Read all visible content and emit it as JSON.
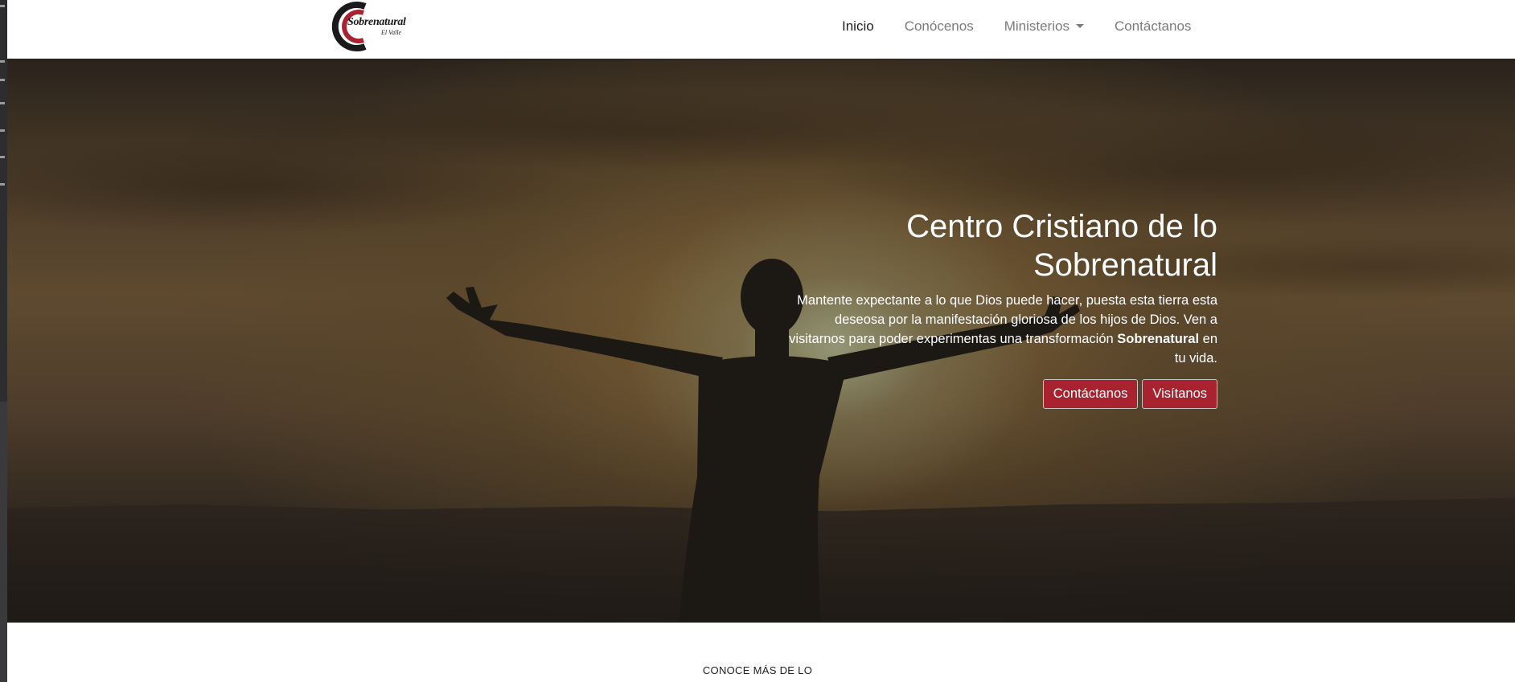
{
  "brand": {
    "logo_text": "Sobrenatural",
    "logo_subtext": "El Valle",
    "colors": {
      "logo_red": "#a8232f",
      "logo_dark": "#1a1a1a"
    }
  },
  "nav": {
    "items": [
      {
        "label": "Inicio",
        "active": true
      },
      {
        "label": "Conócenos",
        "active": false
      },
      {
        "label": "Ministerios",
        "active": false,
        "dropdown": true
      },
      {
        "label": "Contáctanos",
        "active": false
      }
    ],
    "dropdown_icon": "caret-down-icon"
  },
  "hero": {
    "title_line1": "Centro Cristiano de lo",
    "title_line2": "Sobrenatural",
    "text_before_bold": "Mantente expectante a lo que Dios puede hacer, puesta esta tierra esta deseosa por la manifestación gloriosa de los hijos de Dios. Ven a visitarnos para poder experimentas una transformación ",
    "text_bold": "Sobrenatural",
    "text_after_bold": " en tu vida.",
    "buttons": {
      "contact_label": "Contáctanos",
      "visit_label": "Visítanos"
    },
    "colors": {
      "button_bg": "#a8232f"
    }
  },
  "next_section": {
    "label": "CONOCE MÁS DE LO"
  }
}
